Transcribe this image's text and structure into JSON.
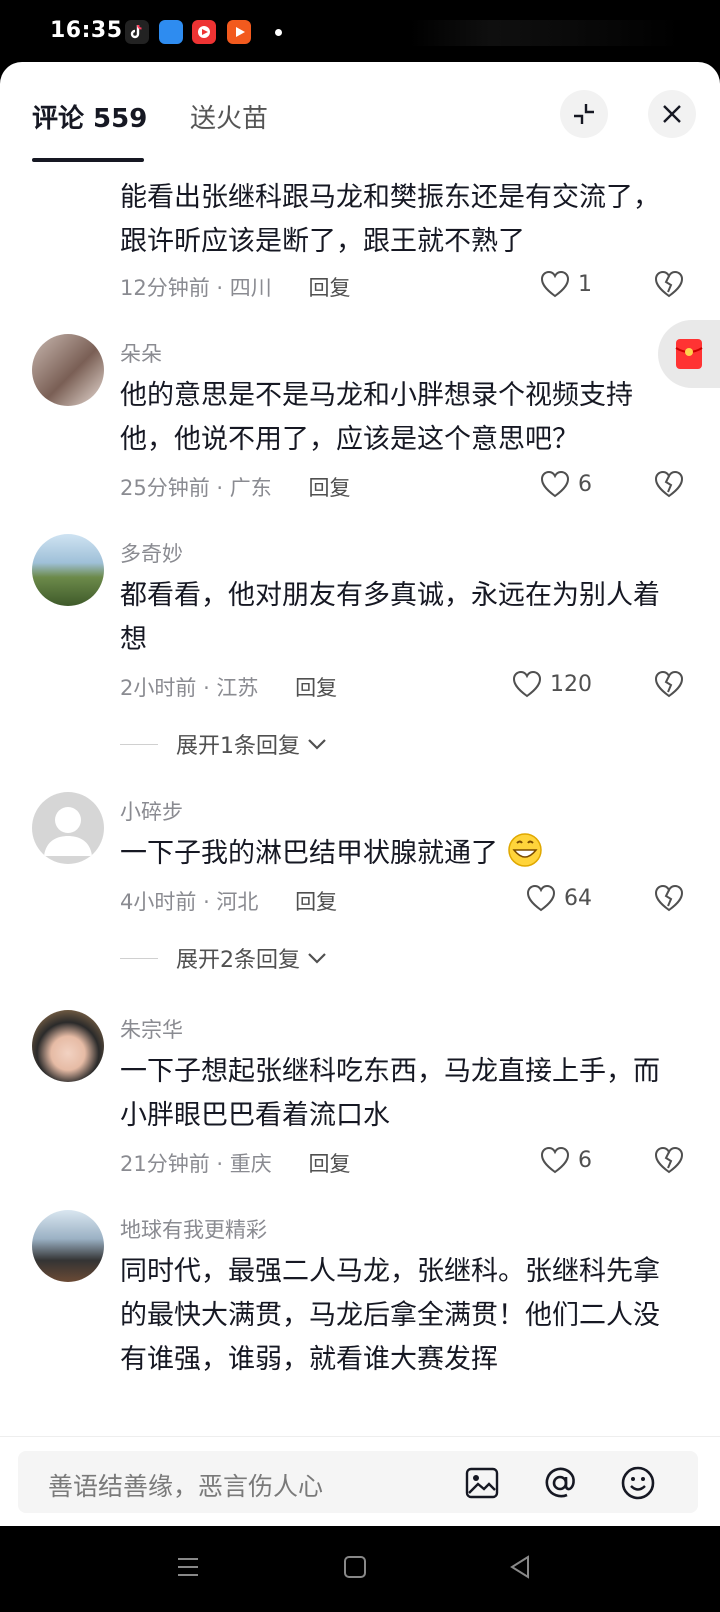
{
  "status_bar": {
    "time": "16:35"
  },
  "tabs": {
    "comments_label": "评论 559",
    "fire_label": "送火苗"
  },
  "comments": [
    {
      "text": "能看出张继科跟马龙和樊振东还是有交流了，跟许昕应该是断了，跟王就不熟了",
      "time": "12分钟前",
      "location": "四川",
      "reply": "回复",
      "likes": "1"
    },
    {
      "username": "朵朵",
      "text": "他的意思是不是马龙和小胖想录个视频支持他，他说不用了，应该是这个意思吧？",
      "time": "25分钟前",
      "location": "广东",
      "reply": "回复",
      "likes": "6"
    },
    {
      "username": "多奇妙",
      "text": "都看看，他对朋友有多真诚，永远在为别人着想",
      "time": "2小时前",
      "location": "江苏",
      "reply": "回复",
      "likes": "120",
      "expand": "展开1条回复"
    },
    {
      "username": "小碎步",
      "text": "一下子我的淋巴结甲状腺就通了",
      "time": "4小时前",
      "location": "河北",
      "reply": "回复",
      "likes": "64",
      "expand": "展开2条回复"
    },
    {
      "username": "朱宗华",
      "text": "一下子想起张继科吃东西，马龙直接上手，而小胖眼巴巴看着流口水",
      "time": "21分钟前",
      "location": "重庆",
      "reply": "回复",
      "likes": "6"
    },
    {
      "username": "地球有我更精彩",
      "text": "同时代，最强二人马龙，张继科。张继科先拿的最快大满贯，马龙后拿全满贯！他们二人没有谁强，谁弱，就看谁大赛发挥"
    }
  ],
  "input": {
    "placeholder": "善语结善缘，恶言伤人心"
  },
  "colors": {
    "accent_red": "#fe2c55",
    "text_primary": "#161823",
    "text_secondary": "#8a8b91"
  }
}
